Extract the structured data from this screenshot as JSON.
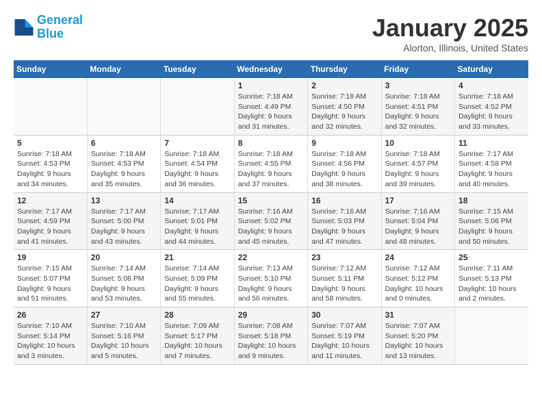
{
  "header": {
    "logo_line1": "General",
    "logo_line2": "Blue",
    "title": "January 2025",
    "subtitle": "Alorton, Illinois, United States"
  },
  "days_of_week": [
    "Sunday",
    "Monday",
    "Tuesday",
    "Wednesday",
    "Thursday",
    "Friday",
    "Saturday"
  ],
  "weeks": [
    [
      {
        "day": "",
        "text": ""
      },
      {
        "day": "",
        "text": ""
      },
      {
        "day": "",
        "text": ""
      },
      {
        "day": "1",
        "text": "Sunrise: 7:18 AM\nSunset: 4:49 PM\nDaylight: 9 hours\nand 31 minutes."
      },
      {
        "day": "2",
        "text": "Sunrise: 7:18 AM\nSunset: 4:50 PM\nDaylight: 9 hours\nand 32 minutes."
      },
      {
        "day": "3",
        "text": "Sunrise: 7:18 AM\nSunset: 4:51 PM\nDaylight: 9 hours\nand 32 minutes."
      },
      {
        "day": "4",
        "text": "Sunrise: 7:18 AM\nSunset: 4:52 PM\nDaylight: 9 hours\nand 33 minutes."
      }
    ],
    [
      {
        "day": "5",
        "text": "Sunrise: 7:18 AM\nSunset: 4:53 PM\nDaylight: 9 hours\nand 34 minutes."
      },
      {
        "day": "6",
        "text": "Sunrise: 7:18 AM\nSunset: 4:53 PM\nDaylight: 9 hours\nand 35 minutes."
      },
      {
        "day": "7",
        "text": "Sunrise: 7:18 AM\nSunset: 4:54 PM\nDaylight: 9 hours\nand 36 minutes."
      },
      {
        "day": "8",
        "text": "Sunrise: 7:18 AM\nSunset: 4:55 PM\nDaylight: 9 hours\nand 37 minutes."
      },
      {
        "day": "9",
        "text": "Sunrise: 7:18 AM\nSunset: 4:56 PM\nDaylight: 9 hours\nand 38 minutes."
      },
      {
        "day": "10",
        "text": "Sunrise: 7:18 AM\nSunset: 4:57 PM\nDaylight: 9 hours\nand 39 minutes."
      },
      {
        "day": "11",
        "text": "Sunrise: 7:17 AM\nSunset: 4:58 PM\nDaylight: 9 hours\nand 40 minutes."
      }
    ],
    [
      {
        "day": "12",
        "text": "Sunrise: 7:17 AM\nSunset: 4:59 PM\nDaylight: 9 hours\nand 41 minutes."
      },
      {
        "day": "13",
        "text": "Sunrise: 7:17 AM\nSunset: 5:00 PM\nDaylight: 9 hours\nand 43 minutes."
      },
      {
        "day": "14",
        "text": "Sunrise: 7:17 AM\nSunset: 5:01 PM\nDaylight: 9 hours\nand 44 minutes."
      },
      {
        "day": "15",
        "text": "Sunrise: 7:16 AM\nSunset: 5:02 PM\nDaylight: 9 hours\nand 45 minutes."
      },
      {
        "day": "16",
        "text": "Sunrise: 7:16 AM\nSunset: 5:03 PM\nDaylight: 9 hours\nand 47 minutes."
      },
      {
        "day": "17",
        "text": "Sunrise: 7:16 AM\nSunset: 5:04 PM\nDaylight: 9 hours\nand 48 minutes."
      },
      {
        "day": "18",
        "text": "Sunrise: 7:15 AM\nSunset: 5:06 PM\nDaylight: 9 hours\nand 50 minutes."
      }
    ],
    [
      {
        "day": "19",
        "text": "Sunrise: 7:15 AM\nSunset: 5:07 PM\nDaylight: 9 hours\nand 51 minutes."
      },
      {
        "day": "20",
        "text": "Sunrise: 7:14 AM\nSunset: 5:08 PM\nDaylight: 9 hours\nand 53 minutes."
      },
      {
        "day": "21",
        "text": "Sunrise: 7:14 AM\nSunset: 5:09 PM\nDaylight: 9 hours\nand 55 minutes."
      },
      {
        "day": "22",
        "text": "Sunrise: 7:13 AM\nSunset: 5:10 PM\nDaylight: 9 hours\nand 56 minutes."
      },
      {
        "day": "23",
        "text": "Sunrise: 7:12 AM\nSunset: 5:11 PM\nDaylight: 9 hours\nand 58 minutes."
      },
      {
        "day": "24",
        "text": "Sunrise: 7:12 AM\nSunset: 5:12 PM\nDaylight: 10 hours\nand 0 minutes."
      },
      {
        "day": "25",
        "text": "Sunrise: 7:11 AM\nSunset: 5:13 PM\nDaylight: 10 hours\nand 2 minutes."
      }
    ],
    [
      {
        "day": "26",
        "text": "Sunrise: 7:10 AM\nSunset: 5:14 PM\nDaylight: 10 hours\nand 3 minutes."
      },
      {
        "day": "27",
        "text": "Sunrise: 7:10 AM\nSunset: 5:16 PM\nDaylight: 10 hours\nand 5 minutes."
      },
      {
        "day": "28",
        "text": "Sunrise: 7:09 AM\nSunset: 5:17 PM\nDaylight: 10 hours\nand 7 minutes."
      },
      {
        "day": "29",
        "text": "Sunrise: 7:08 AM\nSunset: 5:18 PM\nDaylight: 10 hours\nand 9 minutes."
      },
      {
        "day": "30",
        "text": "Sunrise: 7:07 AM\nSunset: 5:19 PM\nDaylight: 10 hours\nand 11 minutes."
      },
      {
        "day": "31",
        "text": "Sunrise: 7:07 AM\nSunset: 5:20 PM\nDaylight: 10 hours\nand 13 minutes."
      },
      {
        "day": "",
        "text": ""
      }
    ]
  ]
}
